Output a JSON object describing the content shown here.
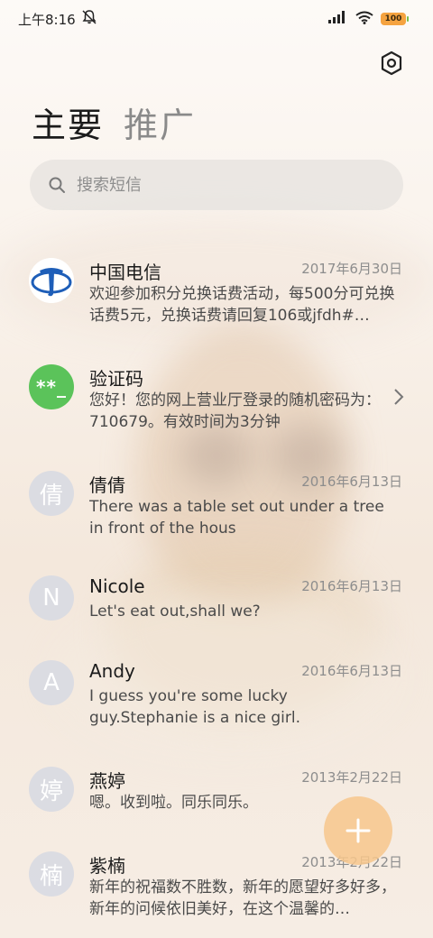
{
  "status_bar": {
    "time": "上午8:16",
    "battery": "100",
    "icons": [
      "mute-bell-icon",
      "signal-icon",
      "wifi-icon",
      "battery-icon"
    ]
  },
  "tabs": [
    {
      "label": "主要",
      "active": true
    },
    {
      "label": "推广",
      "active": false
    }
  ],
  "search": {
    "placeholder": "搜索短信"
  },
  "messages": [
    {
      "sender": "中国电信",
      "date": "2017年6月30日",
      "preview": "欢迎参加积分兑换话费活动，每500分可兑换话费5元，兑换话费请回复106或jfdh#…",
      "avatar_type": "logo"
    },
    {
      "sender": "验证码",
      "date": "",
      "preview": "您好！您的网上营业厅登录的随机密码为：710679。有效时间为3分钟",
      "avatar_type": "code",
      "avatar_text": "**_"
    },
    {
      "sender": "倩倩",
      "date": "2016年6月13日",
      "preview": "There was a table set out under a tree in front of the hous",
      "avatar_type": "letter",
      "avatar_text": "倩"
    },
    {
      "sender": "Nicole",
      "date": "2016年6月13日",
      "preview": "Let's eat out,shall we?",
      "avatar_type": "letter",
      "avatar_text": "N"
    },
    {
      "sender": "Andy",
      "date": "2016年6月13日",
      "preview": "I guess you're some lucky guy.Stephanie is a nice girl.",
      "avatar_type": "letter",
      "avatar_text": "A"
    },
    {
      "sender": "燕婷",
      "date": "2013年2月22日",
      "preview": "嗯。收到啦。同乐同乐。",
      "avatar_type": "letter",
      "avatar_text": "婷"
    },
    {
      "sender": "紫楠",
      "date": "2013年2月22日",
      "preview": "新年的祝福数不胜数，新年的愿望好多好多，新年的问候依旧美好，在这个温馨的…",
      "avatar_type": "letter",
      "avatar_text": "楠"
    }
  ],
  "colors": {
    "accent_fab": "#f7c78c",
    "code_avatar": "#5bc35a",
    "telecom_blue": "#1e5eb8"
  }
}
